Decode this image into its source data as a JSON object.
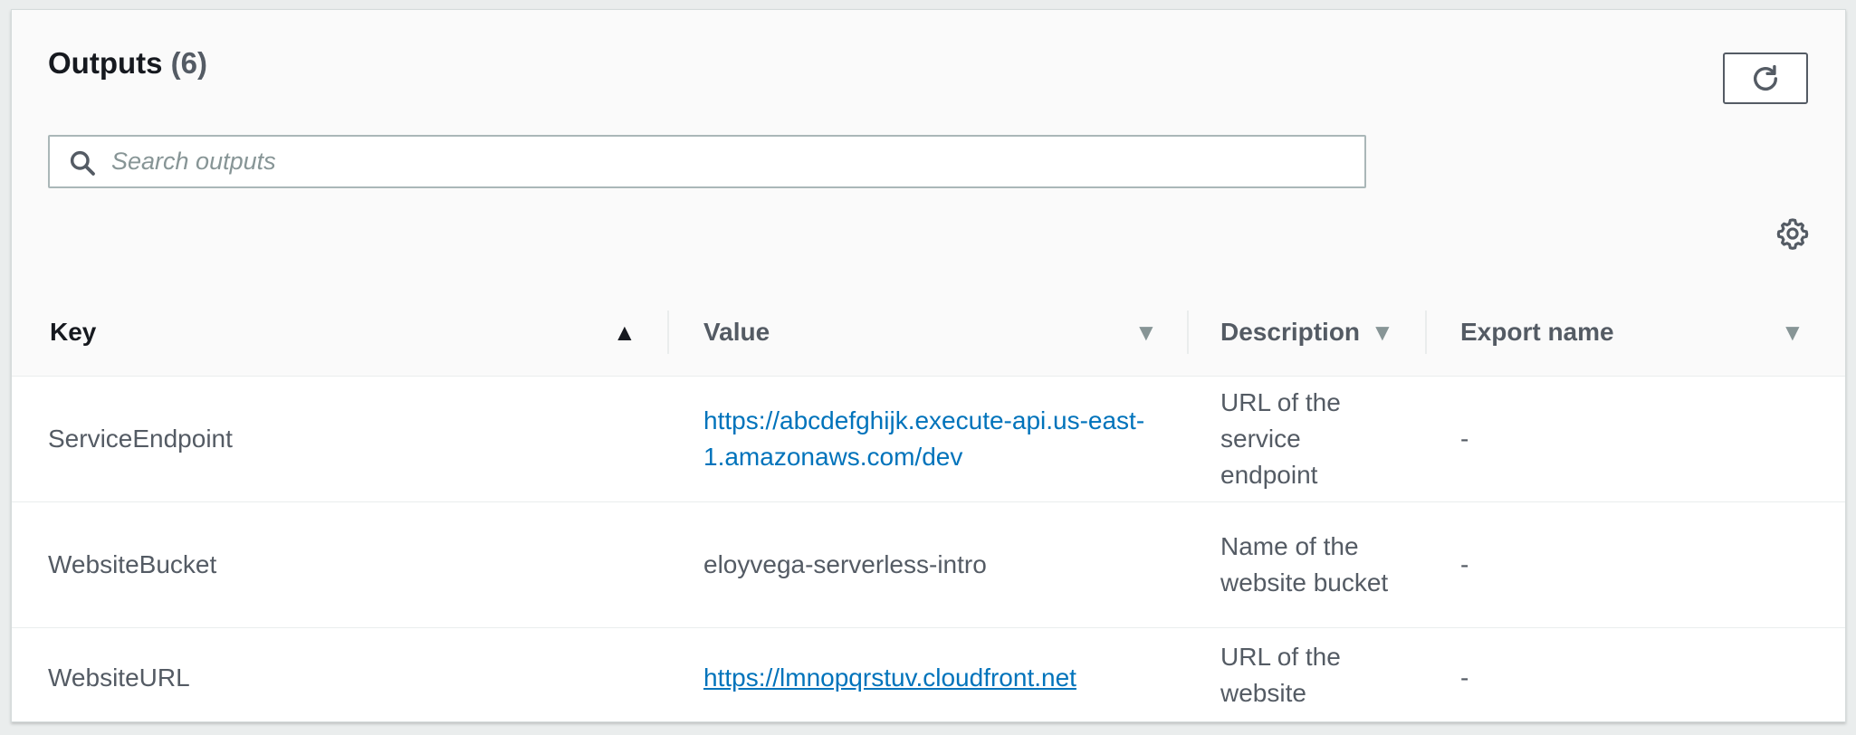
{
  "header": {
    "title": "Outputs",
    "count": "(6)",
    "refresh_icon": "refresh-icon",
    "settings_icon": "gear-icon"
  },
  "search": {
    "placeholder": "Search outputs",
    "value": "",
    "icon": "search-icon"
  },
  "table": {
    "columns": [
      {
        "label": "Key",
        "sort": "ascending"
      },
      {
        "label": "Value",
        "sort": "none"
      },
      {
        "label": "Description",
        "sort": "none"
      },
      {
        "label": "Export name",
        "sort": "none"
      }
    ],
    "rows": [
      {
        "key": "ServiceEndpoint",
        "value": "https://abcdefghijk.execute-api.us-east-1.amazonaws.com/dev",
        "value_is_link": true,
        "description": "URL of the service endpoint",
        "export_name": "-"
      },
      {
        "key": "WebsiteBucket",
        "value": "eloyvega-serverless-intro",
        "value_is_link": false,
        "description": "Name of the website bucket",
        "export_name": "-"
      },
      {
        "key": "WebsiteURL",
        "value": "https://lmnopqrstuv.cloudfront.net",
        "value_is_link": true,
        "description": "URL of the website",
        "export_name": "-"
      }
    ]
  },
  "colors": {
    "link": "#0073bb",
    "text_primary": "#16191f",
    "text_secondary": "#545b64",
    "border": "#eaeded"
  }
}
